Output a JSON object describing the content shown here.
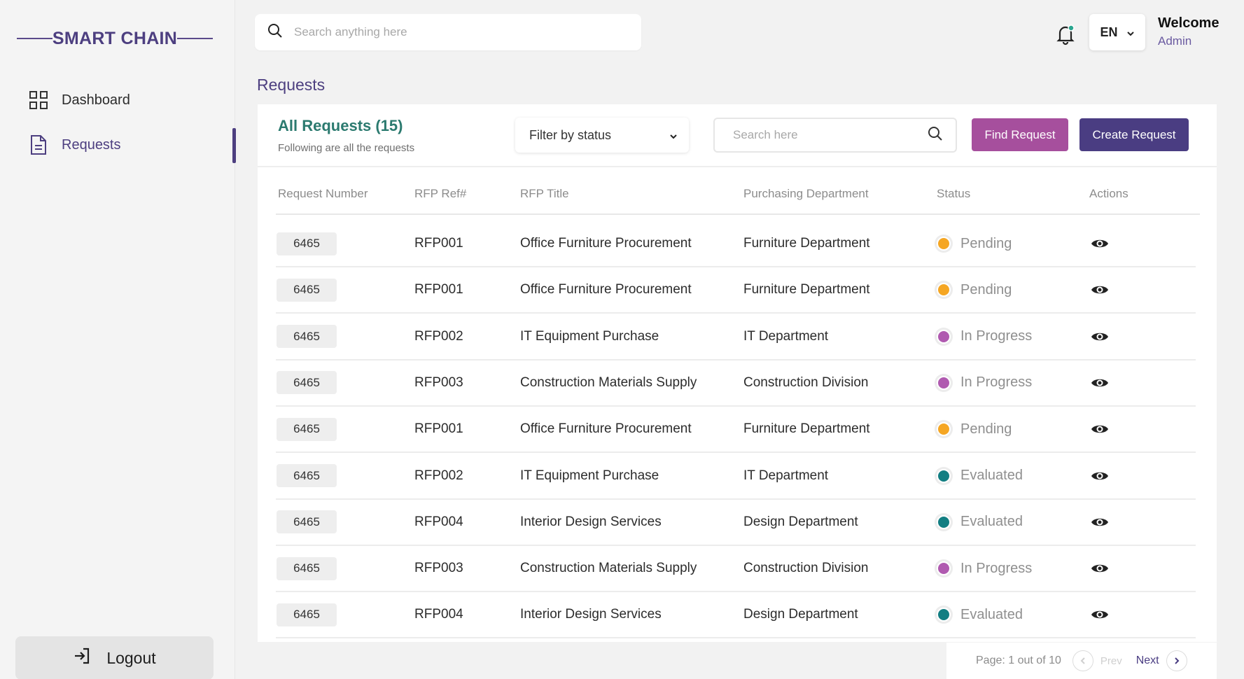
{
  "app": {
    "logo": "SMART CHAIN"
  },
  "sidebar": {
    "items": [
      {
        "label": "Dashboard",
        "icon": "grid-icon"
      },
      {
        "label": "Requests",
        "icon": "document-icon"
      }
    ],
    "logout_label": "Logout"
  },
  "header": {
    "search_placeholder": "Search anything here",
    "language": "EN",
    "welcome": "Welcome",
    "user": "Admin"
  },
  "page": {
    "title": "Requests"
  },
  "card": {
    "title": "All Requests (15)",
    "subtitle": "Following are all the requests",
    "filter_label": "Filter by status",
    "search_placeholder": "Search here",
    "find_button": "Find Request",
    "create_button": "Create Request"
  },
  "table": {
    "headers": [
      "Request Number",
      "RFP Ref#",
      "RFP Title",
      "Purchasing Department",
      "Status",
      "Actions"
    ],
    "rows": [
      {
        "number": "6465",
        "ref": "RFP001",
        "title": "Office Furniture Procurement",
        "department": "Furniture Department",
        "status": "Pending"
      },
      {
        "number": "6465",
        "ref": "RFP001",
        "title": "Office Furniture Procurement",
        "department": "Furniture Department",
        "status": "Pending"
      },
      {
        "number": "6465",
        "ref": "RFP002",
        "title": "IT Equipment Purchase",
        "department": "IT Department",
        "status": "In Progress"
      },
      {
        "number": "6465",
        "ref": "RFP003",
        "title": "Construction Materials Supply",
        "department": "Construction Division",
        "status": "In Progress"
      },
      {
        "number": "6465",
        "ref": "RFP001",
        "title": "Office Furniture Procurement",
        "department": "Furniture Department",
        "status": "Pending"
      },
      {
        "number": "6465",
        "ref": "RFP002",
        "title": "IT Equipment Purchase",
        "department": "IT Department",
        "status": "Evaluated"
      },
      {
        "number": "6465",
        "ref": "RFP004",
        "title": "Interior Design Services",
        "department": "Design Department",
        "status": "Evaluated"
      },
      {
        "number": "6465",
        "ref": "RFP003",
        "title": "Construction Materials Supply",
        "department": "Construction Division",
        "status": "In Progress"
      },
      {
        "number": "6465",
        "ref": "RFP004",
        "title": "Interior Design Services",
        "department": "Design Department",
        "status": "Evaluated"
      }
    ]
  },
  "status_colors": {
    "Pending": "#f5a623",
    "In Progress": "#b05ab0",
    "Evaluated": "#127e82"
  },
  "pagination": {
    "text": "Page: 1 out of 10",
    "prev": "Prev",
    "next": "Next"
  }
}
